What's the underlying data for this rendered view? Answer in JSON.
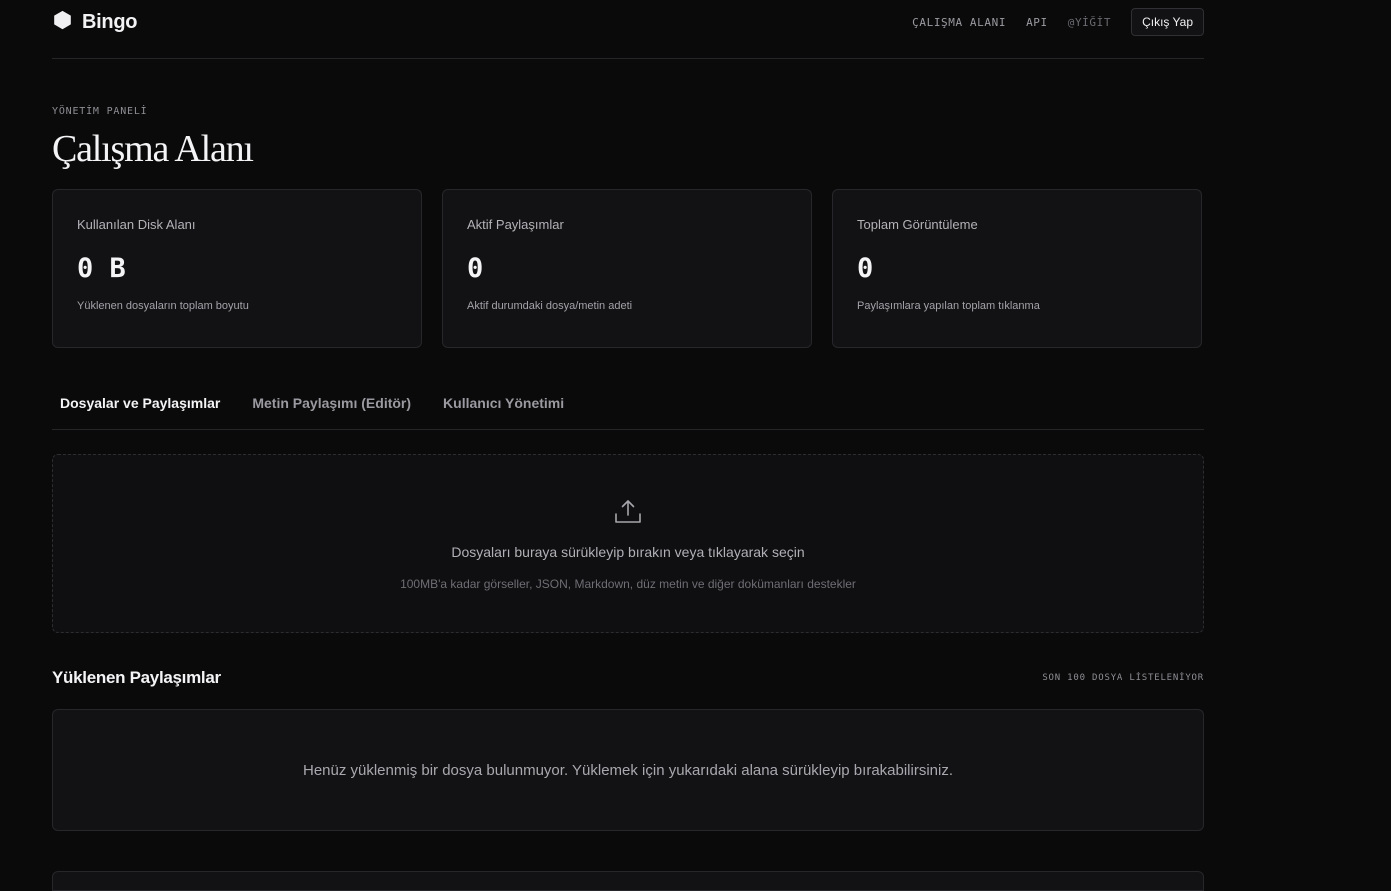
{
  "header": {
    "brand": "Bingo",
    "nav": {
      "workspace": "ÇALIŞMA ALANI",
      "api": "API",
      "user": "@YİĞİT"
    },
    "logout_label": "Çıkış Yap"
  },
  "page": {
    "eyebrow": "YÖNETİM PANELİ",
    "title": "Çalışma Alanı"
  },
  "stats": [
    {
      "label": "Kullanılan Disk Alanı",
      "value": "0 B",
      "desc": "Yüklenen dosyaların toplam boyutu"
    },
    {
      "label": "Aktif Paylaşımlar",
      "value": "0",
      "desc": "Aktif durumdaki dosya/metin adeti"
    },
    {
      "label": "Toplam Görüntüleme",
      "value": "0",
      "desc": "Paylaşımlara yapılan toplam tıklanma"
    }
  ],
  "tabs": [
    {
      "label": "Dosyalar ve Paylaşımlar",
      "active": true
    },
    {
      "label": "Metin Paylaşımı (Editör)",
      "active": false
    },
    {
      "label": "Kullanıcı Yönetimi",
      "active": false
    }
  ],
  "dropzone": {
    "icon": "upload-icon",
    "title": "Dosyaları buraya sürükleyip bırakın veya tıklayarak seçin",
    "subtitle": "100MB'a kadar görseller, JSON, Markdown, düz metin ve diğer dokümanları destekler"
  },
  "uploads": {
    "title": "Yüklenen Paylaşımlar",
    "meta": "SON 100 DOSYA LİSTELENİYOR",
    "empty": "Henüz yüklenmiş bir dosya bulunmuyor. Yüklemek için yukarıdaki alana sürükleyip bırakabilirsiniz."
  },
  "colors": {
    "background": "#0a0a0b",
    "card": "#121214",
    "border": "#27272b",
    "text": "#f4f4f6"
  }
}
